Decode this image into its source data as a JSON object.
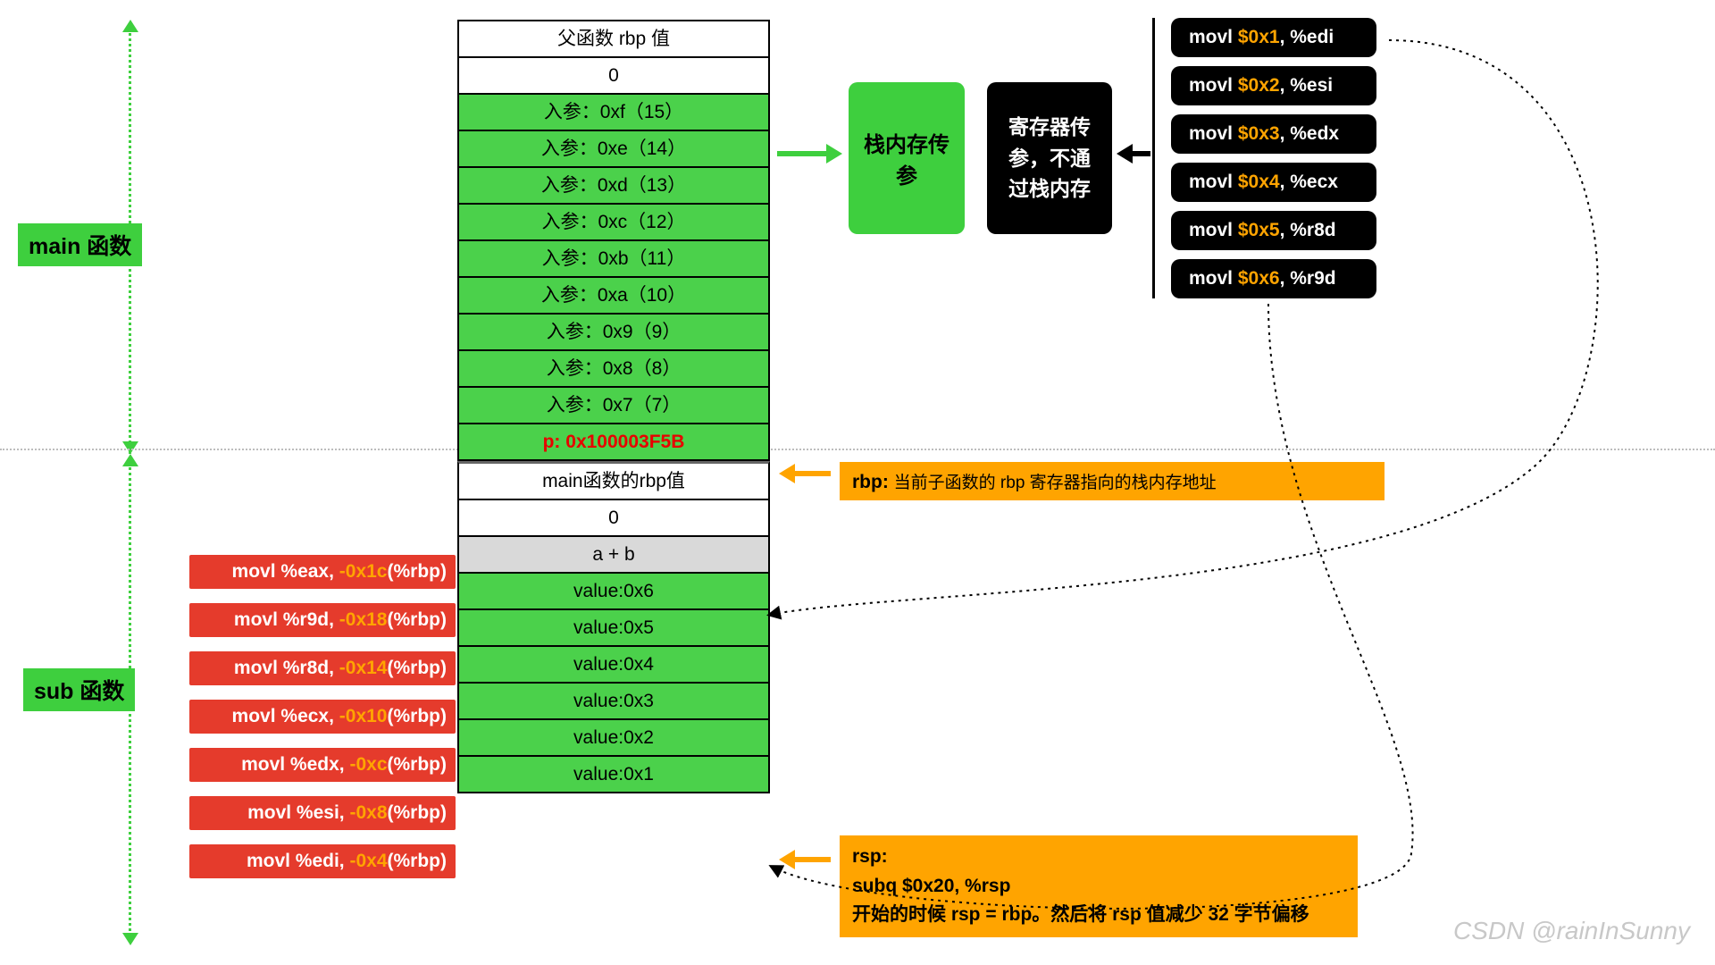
{
  "labels": {
    "main": "main 函数",
    "sub": "sub 函数",
    "mid_green": "栈内存传参",
    "mid_black": "寄存器传参，不通过栈内存"
  },
  "stack": {
    "r0": "父函数 rbp 值",
    "r1": "0",
    "r2": "入参：0xf（15）",
    "r3": "入参：0xe（14）",
    "r4": "入参：0xd（13）",
    "r5": "入参：0xc（12）",
    "r6": "入参：0xb（11）",
    "r7": "入参：0xa（10）",
    "r8": "入参：0x9（9）",
    "r9": "入参：0x8（8）",
    "r10": "入参：0x7（7）",
    "r11": "p: 0x100003F5B",
    "r12": "main函数的rbp值",
    "r13": "0",
    "r14": "a + b",
    "r15": "value:0x6",
    "r16": "value:0x5",
    "r17": "value:0x4",
    "r18": "value:0x3",
    "r19": "value:0x2",
    "r20": "value:0x1"
  },
  "asm_left": {
    "i0": {
      "pre": "movl   %eax, ",
      "off": "-0x1c",
      "post": "(%rbp)"
    },
    "i1": {
      "pre": "movl   %r9d, ",
      "off": "-0x18",
      "post": "(%rbp)"
    },
    "i2": {
      "pre": "movl   %r8d, ",
      "off": "-0x14",
      "post": "(%rbp)"
    },
    "i3": {
      "pre": "movl   %ecx, ",
      "off": "-0x10",
      "post": "(%rbp)"
    },
    "i4": {
      "pre": "movl   %edx, ",
      "off": "-0xc",
      "post": "(%rbp)"
    },
    "i5": {
      "pre": "movl   %esi, ",
      "off": "-0x8",
      "post": "(%rbp)"
    },
    "i6": {
      "pre": "movl   %edi, ",
      "off": "-0x4",
      "post": "(%rbp)"
    }
  },
  "asm_right": {
    "i0": {
      "pre": "movl   ",
      "imm": "$0x1",
      "post": ", %edi"
    },
    "i1": {
      "pre": "movl   ",
      "imm": "$0x2",
      "post": ", %esi"
    },
    "i2": {
      "pre": "movl   ",
      "imm": "$0x3",
      "post": ", %edx"
    },
    "i3": {
      "pre": "movl   ",
      "imm": "$0x4",
      "post": ", %ecx"
    },
    "i4": {
      "pre": "movl   ",
      "imm": "$0x5",
      "post": ", %r8d"
    },
    "i5": {
      "pre": "movl   ",
      "imm": "$0x6",
      "post": ", %r9d"
    }
  },
  "callouts": {
    "rbp_bold": "rbp: ",
    "rbp_text": "当前子函数的 rbp 寄存器指向的栈内存地址",
    "rsp_l1": "rsp:",
    "rsp_l2": "subq   $0x20, %rsp",
    "rsp_l3": "开始的时候 rsp = rbp。然后将 rsp 值减少 32 字节偏移"
  },
  "watermark": "CSDN @rainInSunny"
}
